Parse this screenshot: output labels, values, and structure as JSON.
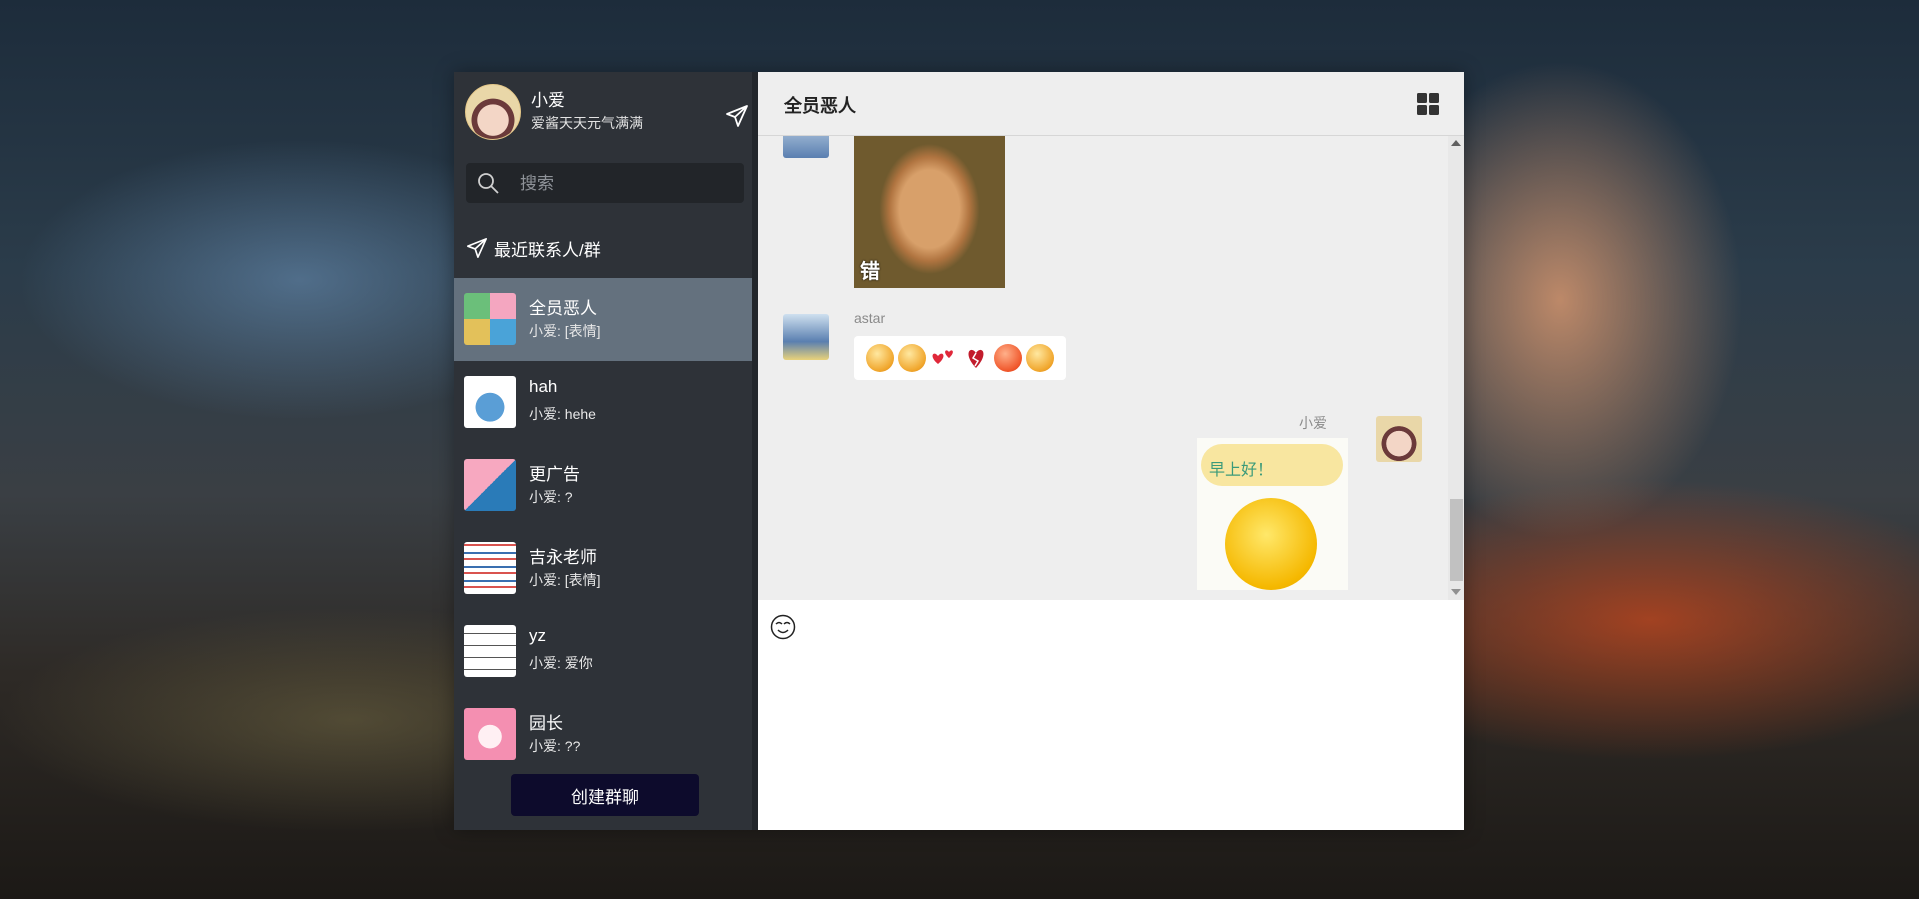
{
  "sidebar": {
    "profile": {
      "name": "小爱",
      "status": "爱酱天天元气满满"
    },
    "search": {
      "placeholder": "搜索"
    },
    "recent_title": "最近联系人/群",
    "contacts": [
      {
        "name": "全员恶人",
        "last": "小爱: [表情]",
        "active": true
      },
      {
        "name": "hah",
        "last": "小爱: hehe",
        "active": false
      },
      {
        "name": "更广告",
        "last": "小爱: ?",
        "active": false
      },
      {
        "name": "吉永老师",
        "last": "小爱: [表情]",
        "active": false
      },
      {
        "name": "yz",
        "last": "小爱: 爱你",
        "active": false
      },
      {
        "name": "园长",
        "last": "小爱: ??",
        "active": false
      }
    ],
    "create_group_label": "创建群聊"
  },
  "chat": {
    "title": "全员恶人",
    "messages": [
      {
        "sender": "",
        "type": "image",
        "image_caption": "错",
        "side": "left"
      },
      {
        "sender": "astar",
        "type": "emoji",
        "side": "left"
      },
      {
        "sender": "小爱",
        "type": "image",
        "image_caption": "早上好！",
        "side": "right"
      }
    ]
  },
  "icons": {
    "send": "paper-plane-icon",
    "search": "search-icon",
    "grid": "grid-icon",
    "emoji": "smiley-icon"
  },
  "colors": {
    "sidebar_bg": "#2e3238",
    "active_item": "#64717e",
    "create_button": "#0d0b2c",
    "chat_bg": "#eeeeee"
  }
}
